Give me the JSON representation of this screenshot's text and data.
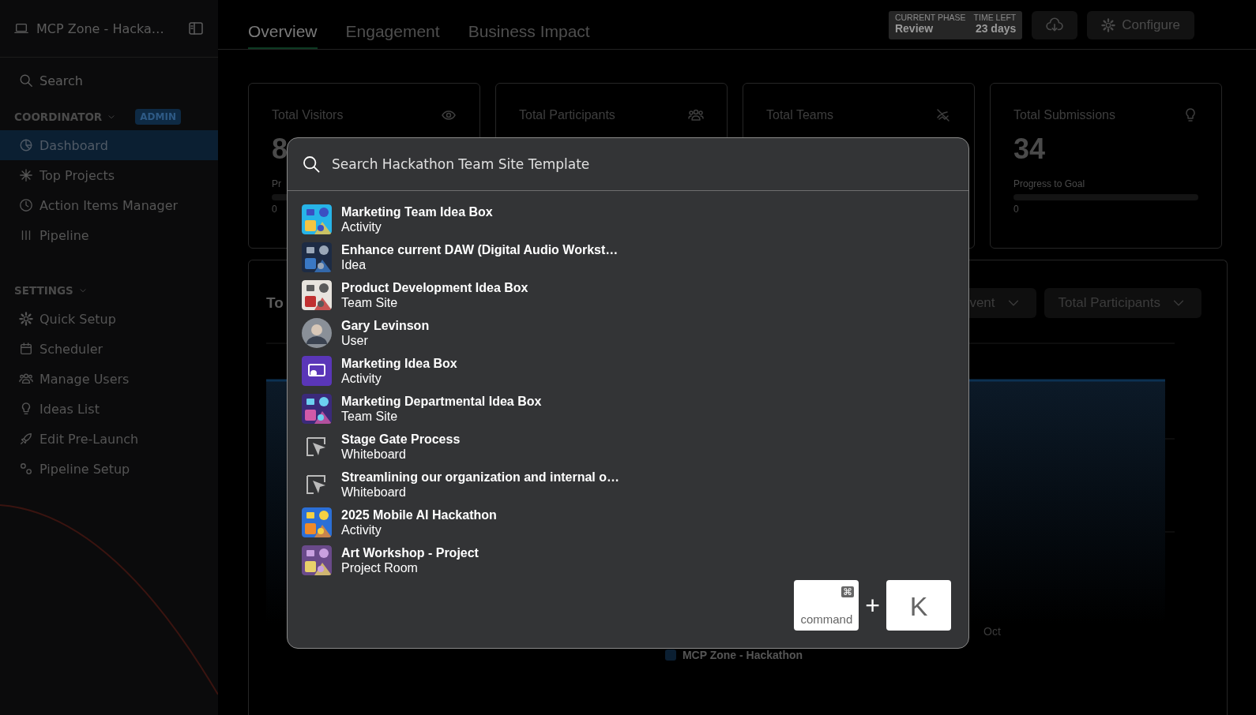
{
  "sidebar": {
    "workspace": "MCP Zone - Hacka…",
    "search": "Search",
    "sections": [
      {
        "title": "COORDINATOR",
        "badge": "ADMIN",
        "items": [
          {
            "label": "Dashboard",
            "selected": true
          },
          {
            "label": "Top Projects",
            "selected": false
          },
          {
            "label": "Action Items Manager",
            "selected": false
          },
          {
            "label": "Pipeline",
            "selected": false
          }
        ]
      },
      {
        "title": "SETTINGS",
        "items": [
          {
            "label": "Quick Setup",
            "selected": false
          },
          {
            "label": "Scheduler",
            "selected": false
          },
          {
            "label": "Manage Users",
            "selected": false
          },
          {
            "label": "Ideas List",
            "selected": false
          },
          {
            "label": "Edit Pre-Launch",
            "selected": false
          },
          {
            "label": "Pipeline Setup",
            "selected": false
          }
        ]
      }
    ]
  },
  "tabs": [
    {
      "label": "Overview",
      "selected": true
    },
    {
      "label": "Engagement",
      "selected": false
    },
    {
      "label": "Business Impact",
      "selected": false
    }
  ],
  "phase": {
    "phase_label": "CURRENT PHASE",
    "phase": "Review",
    "time_label": "TIME LEFT",
    "time": "23 days"
  },
  "configure_button": "Configure",
  "cards": [
    {
      "label": "Total Visitors",
      "value": "8",
      "progress_label": "Pr",
      "progress": "0"
    },
    {
      "label": "Total Participants"
    },
    {
      "label": "Total Teams"
    },
    {
      "label": "Total Submissions",
      "value": "34",
      "progress_label": "Progress to Goal",
      "progress": "0"
    }
  ],
  "chart_panel": {
    "title": "To",
    "dropdowns": [
      "vent",
      "Total Participants"
    ],
    "x_tick": "Oct",
    "legend": "MCP Zone - Hackathon"
  },
  "search_dialog": {
    "placeholder": "Search Hackathon Team Site Template",
    "results": [
      {
        "title": "Marketing Team Idea Box",
        "type": "Activity",
        "kind": "picture"
      },
      {
        "title": "Enhance current DAW (Digital Audio Workst…",
        "type": "Idea",
        "kind": "picture"
      },
      {
        "title": "Product Development Idea Box",
        "type": "Team Site",
        "kind": "picture"
      },
      {
        "title": "Gary Levinson",
        "type": "User",
        "kind": "avatar"
      },
      {
        "title": "Marketing Idea Box",
        "type": "Activity",
        "kind": "logo"
      },
      {
        "title": "Marketing Departmental Idea Box",
        "type": "Team Site",
        "kind": "picture"
      },
      {
        "title": "Stage Gate Process",
        "type": "Whiteboard",
        "kind": "whiteboard"
      },
      {
        "title": "Streamlining our organization and internal o…",
        "type": "Whiteboard",
        "kind": "whiteboard"
      },
      {
        "title": "2025 Mobile AI Hackathon",
        "type": "Activity",
        "kind": "picture"
      },
      {
        "title": "Art Workshop - Project",
        "type": "Project Room",
        "kind": "picture"
      }
    ],
    "shortcut": {
      "symbol": "⌘",
      "modifier": "command",
      "plus": "+",
      "key": "K"
    }
  }
}
